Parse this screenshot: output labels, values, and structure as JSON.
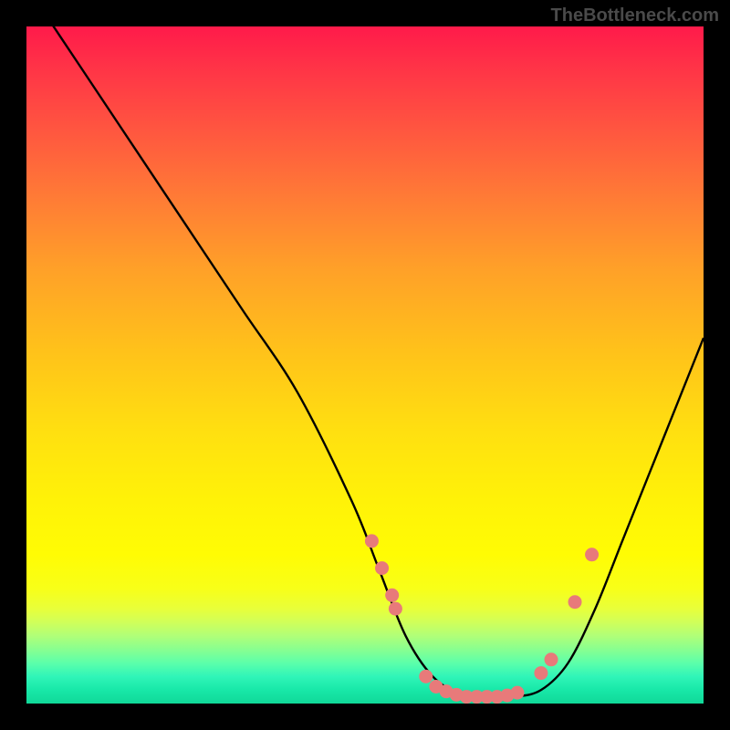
{
  "watermark": "TheBottleneck.com",
  "chart_data": {
    "type": "line",
    "title": "",
    "xlabel": "",
    "ylabel": "",
    "xlim": [
      0,
      100
    ],
    "ylim": [
      0,
      100
    ],
    "series": [
      {
        "name": "bottleneck-curve",
        "x": [
          0,
          8,
          16,
          24,
          32,
          40,
          48,
          52,
          56,
          60,
          64,
          68,
          72,
          76,
          80,
          84,
          88,
          92,
          96,
          100
        ],
        "y": [
          106,
          94,
          82,
          70,
          58,
          46,
          30,
          20,
          10,
          4,
          1.5,
          1,
          1,
          2,
          6,
          14,
          24,
          34,
          44,
          54
        ]
      }
    ],
    "markers": {
      "name": "highlight-dots",
      "color": "#e87a7a",
      "x": [
        51,
        52.5,
        54,
        54.5,
        59,
        60.5,
        62,
        63.5,
        65,
        66.5,
        68,
        69.5,
        71,
        72.5,
        76,
        77.5,
        81,
        83.5
      ],
      "y": [
        24,
        20,
        16,
        14,
        4,
        2.5,
        1.8,
        1.3,
        1,
        1,
        1,
        1,
        1.2,
        1.6,
        4.5,
        6.5,
        15,
        22
      ]
    }
  }
}
